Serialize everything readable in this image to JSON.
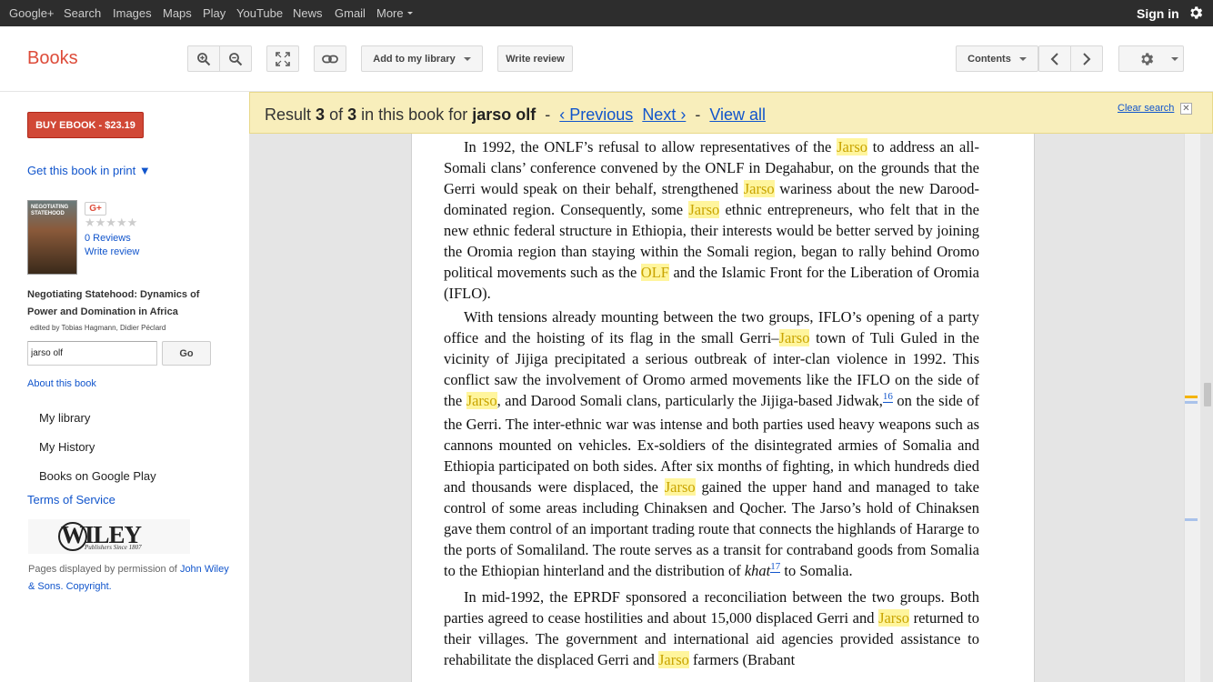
{
  "topnav": {
    "items": [
      "Google+",
      "Search",
      "Images",
      "Maps",
      "Play",
      "YouTube",
      "News",
      "Gmail",
      "More"
    ],
    "signin": "Sign in"
  },
  "toolbar": {
    "title": "Books",
    "add_library": "Add to my library",
    "write_review": "Write review",
    "contents": "Contents"
  },
  "sidebar": {
    "buy": "BUY EBOOK - $23.19",
    "get_print": "Get this book in print ▼",
    "gplus": "G+",
    "stars": "★★★★★",
    "reviews": "0 Reviews",
    "write_review": "Write review",
    "cover_text": "NEGOTIATING STATEHOOD",
    "book_title": "Negotiating Statehood: Dynamics of Power and Domination in Africa",
    "editors": "edited by Tobias Hagmann, Didier Péclard",
    "search_value": "jarso olf",
    "go": "Go",
    "about": "About this book",
    "links": [
      "My library",
      "My History",
      "Books on Google Play"
    ],
    "tos": "Terms of Service",
    "publisher_logo": "WILEY",
    "publisher_tag": "Publishers Since 1807",
    "permission_prefix": "Pages displayed by permission of",
    "permission_link": "John Wiley & Sons",
    "permission_suffix": ". Copyright."
  },
  "result": {
    "prefix": "Result",
    "current": "3",
    "of": "of",
    "total": "3",
    "mid": "in this book for",
    "query": "jarso olf",
    "dash1": "-",
    "previous": "‹ Previous",
    "next": "Next ›",
    "dash2": "-",
    "view_all": "View all",
    "clear": "Clear search"
  },
  "page_text": {
    "p1": [
      {
        "t": "In 1992, the ONLF’s refusal to allow representatives of the "
      },
      {
        "t": "Jarso",
        "h": true
      },
      {
        "t": " to address an all-Somali clans’ conference convened by the ONLF in Degahabur, on the grounds that the Gerri would speak on their behalf, strengthened "
      },
      {
        "t": "Jarso",
        "h": true
      },
      {
        "t": " wariness about the new Darood-dominated region. Consequently, some "
      },
      {
        "t": "Jarso",
        "h": true
      },
      {
        "t": " ethnic entrepreneurs, who felt that in the new ethnic federal structure in Ethiopia, their interests would be better served by joining the Oromia region than staying within the Somali region, began to rally behind Oromo political movements such as the "
      },
      {
        "t": "OLF",
        "h": true
      },
      {
        "t": " and the Islamic Front for the Liberation of Oromia (IFLO)."
      }
    ],
    "p2": [
      {
        "t": "With tensions already mounting between the two groups, IFLO’s opening of a party office and the hoisting of its flag in the small Gerri–"
      },
      {
        "t": "Jarso",
        "h": true
      },
      {
        "t": " town of Tuli Guled in the vicinity of Jijiga precipitated a serious outbreak of inter-clan violence in 1992. This conflict saw the involvement of Oromo armed movements like the IFLO on the side of the "
      },
      {
        "t": "Jarso",
        "h": true
      },
      {
        "t": ", and Darood Somali clans, particularly the Jijiga-based Jidwak,"
      },
      {
        "t": "16",
        "fn": true
      },
      {
        "t": " on the side of the Gerri. The inter-ethnic war was intense and both parties used heavy weapons such as cannons mounted on vehicles. Ex-soldiers of the disintegrated armies of Somalia and Ethiopia participated on both sides. After six months of fighting, in which hundreds died and thousands were displaced, the "
      },
      {
        "t": "Jarso",
        "h": true
      },
      {
        "t": " gained the upper hand and managed to take control of some areas including Chinaksen and Qocher. The Jarso’s hold of Chinaksen gave them control of an important trading route that connects the highlands of Hararge to the ports of Somaliland. The route serves as a transit for contraband goods from Somalia to the Ethiopian hinterland and the distribution of "
      },
      {
        "t": "khat",
        "i": true
      },
      {
        "t": "17",
        "fn": true
      },
      {
        "t": " to Somalia."
      }
    ],
    "p3": [
      {
        "t": "In mid-1992, the EPRDF sponsored a reconciliation between the two groups. Both parties agreed to cease hostilities and about 15,000 displaced Gerri and "
      },
      {
        "t": "Jarso",
        "h": true
      },
      {
        "t": " returned to their villages. The government and international aid agencies provided assistance to rehabilitate the displaced Gerri and "
      },
      {
        "t": "Jarso",
        "h": true
      },
      {
        "t": " farmers (Brabant"
      }
    ]
  },
  "colors": {
    "accent": "#dd4b39",
    "link": "#1155cc",
    "highlight": "#fff59d",
    "result_bar": "#f8eebb"
  }
}
